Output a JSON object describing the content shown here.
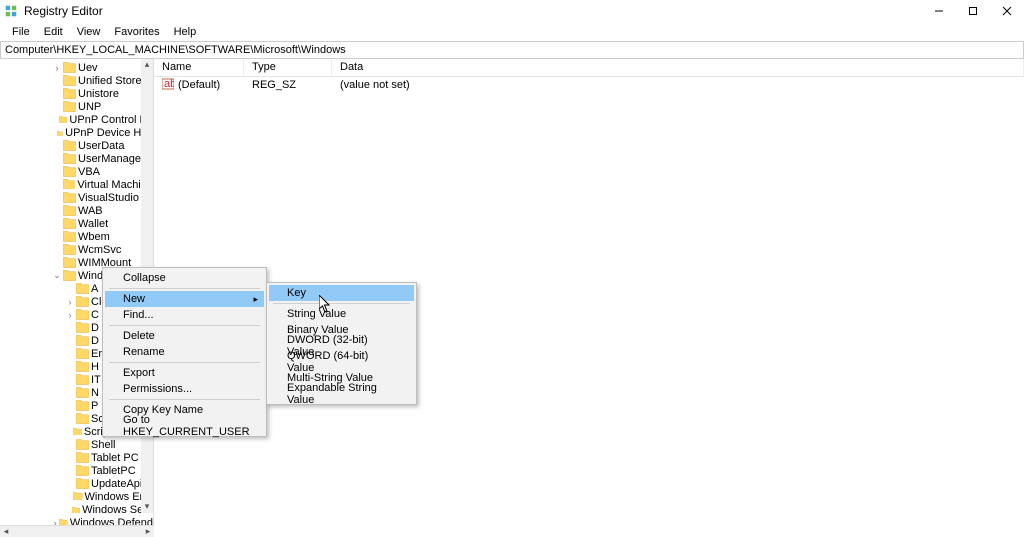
{
  "window": {
    "title": "Registry Editor"
  },
  "menu": {
    "items": [
      "File",
      "Edit",
      "View",
      "Favorites",
      "Help"
    ]
  },
  "address": "Computer\\HKEY_LOCAL_MACHINE\\SOFTWARE\\Microsoft\\Windows",
  "tree": {
    "items": [
      {
        "label": "Uev",
        "depth": 4,
        "exp": ">"
      },
      {
        "label": "Unified Store",
        "depth": 4,
        "exp": ""
      },
      {
        "label": "Unistore",
        "depth": 4,
        "exp": ""
      },
      {
        "label": "UNP",
        "depth": 4,
        "exp": ""
      },
      {
        "label": "UPnP Control Po",
        "depth": 4,
        "exp": ""
      },
      {
        "label": "UPnP Device Hos",
        "depth": 4,
        "exp": ""
      },
      {
        "label": "UserData",
        "depth": 4,
        "exp": ""
      },
      {
        "label": "UserManager",
        "depth": 4,
        "exp": ""
      },
      {
        "label": "VBA",
        "depth": 4,
        "exp": ""
      },
      {
        "label": "Virtual Machine",
        "depth": 4,
        "exp": ""
      },
      {
        "label": "VisualStudio",
        "depth": 4,
        "exp": ""
      },
      {
        "label": "WAB",
        "depth": 4,
        "exp": ""
      },
      {
        "label": "Wallet",
        "depth": 4,
        "exp": ""
      },
      {
        "label": "Wbem",
        "depth": 4,
        "exp": ""
      },
      {
        "label": "WcmSvc",
        "depth": 4,
        "exp": ""
      },
      {
        "label": "WIMMount",
        "depth": 4,
        "exp": ""
      },
      {
        "label": "Wind",
        "depth": 4,
        "exp": "v"
      },
      {
        "label": "A",
        "depth": 5,
        "exp": ""
      },
      {
        "label": "Cl",
        "depth": 5,
        "exp": ">"
      },
      {
        "label": "C",
        "depth": 5,
        "exp": ">"
      },
      {
        "label": "D",
        "depth": 5,
        "exp": ""
      },
      {
        "label": "D",
        "depth": 5,
        "exp": ""
      },
      {
        "label": "Er",
        "depth": 5,
        "exp": ""
      },
      {
        "label": "H",
        "depth": 5,
        "exp": ""
      },
      {
        "label": "IT",
        "depth": 5,
        "exp": ""
      },
      {
        "label": "N",
        "depth": 5,
        "exp": ""
      },
      {
        "label": "P",
        "depth": 5,
        "exp": ""
      },
      {
        "label": "Sc",
        "depth": 5,
        "exp": ""
      },
      {
        "label": "ScriptedDiagn",
        "depth": 5,
        "exp": ""
      },
      {
        "label": "Shell",
        "depth": 5,
        "exp": ""
      },
      {
        "label": "Tablet PC",
        "depth": 5,
        "exp": ""
      },
      {
        "label": "TabletPC",
        "depth": 5,
        "exp": ""
      },
      {
        "label": "UpdateApi",
        "depth": 5,
        "exp": ""
      },
      {
        "label": "Windows Erro",
        "depth": 5,
        "exp": ""
      },
      {
        "label": "Windows Sear",
        "depth": 5,
        "exp": ""
      },
      {
        "label": "Windows Defend",
        "depth": 4,
        "exp": ">"
      }
    ]
  },
  "listview": {
    "columns": {
      "name": "Name",
      "type": "Type",
      "data": "Data"
    },
    "row": {
      "name": "(Default)",
      "type": "REG_SZ",
      "data": "(value not set)"
    }
  },
  "ctx1": {
    "collapse": "Collapse",
    "new": "New",
    "find": "Find...",
    "delete": "Delete",
    "rename": "Rename",
    "export": "Export",
    "permissions": "Permissions...",
    "copykey": "Copy Key Name",
    "goto": "Go to HKEY_CURRENT_USER"
  },
  "ctx2": {
    "key": "Key",
    "string": "String Value",
    "binary": "Binary Value",
    "dword": "DWORD (32-bit) Value",
    "qword": "QWORD (64-bit) Value",
    "multi": "Multi-String Value",
    "expand": "Expandable String Value"
  }
}
